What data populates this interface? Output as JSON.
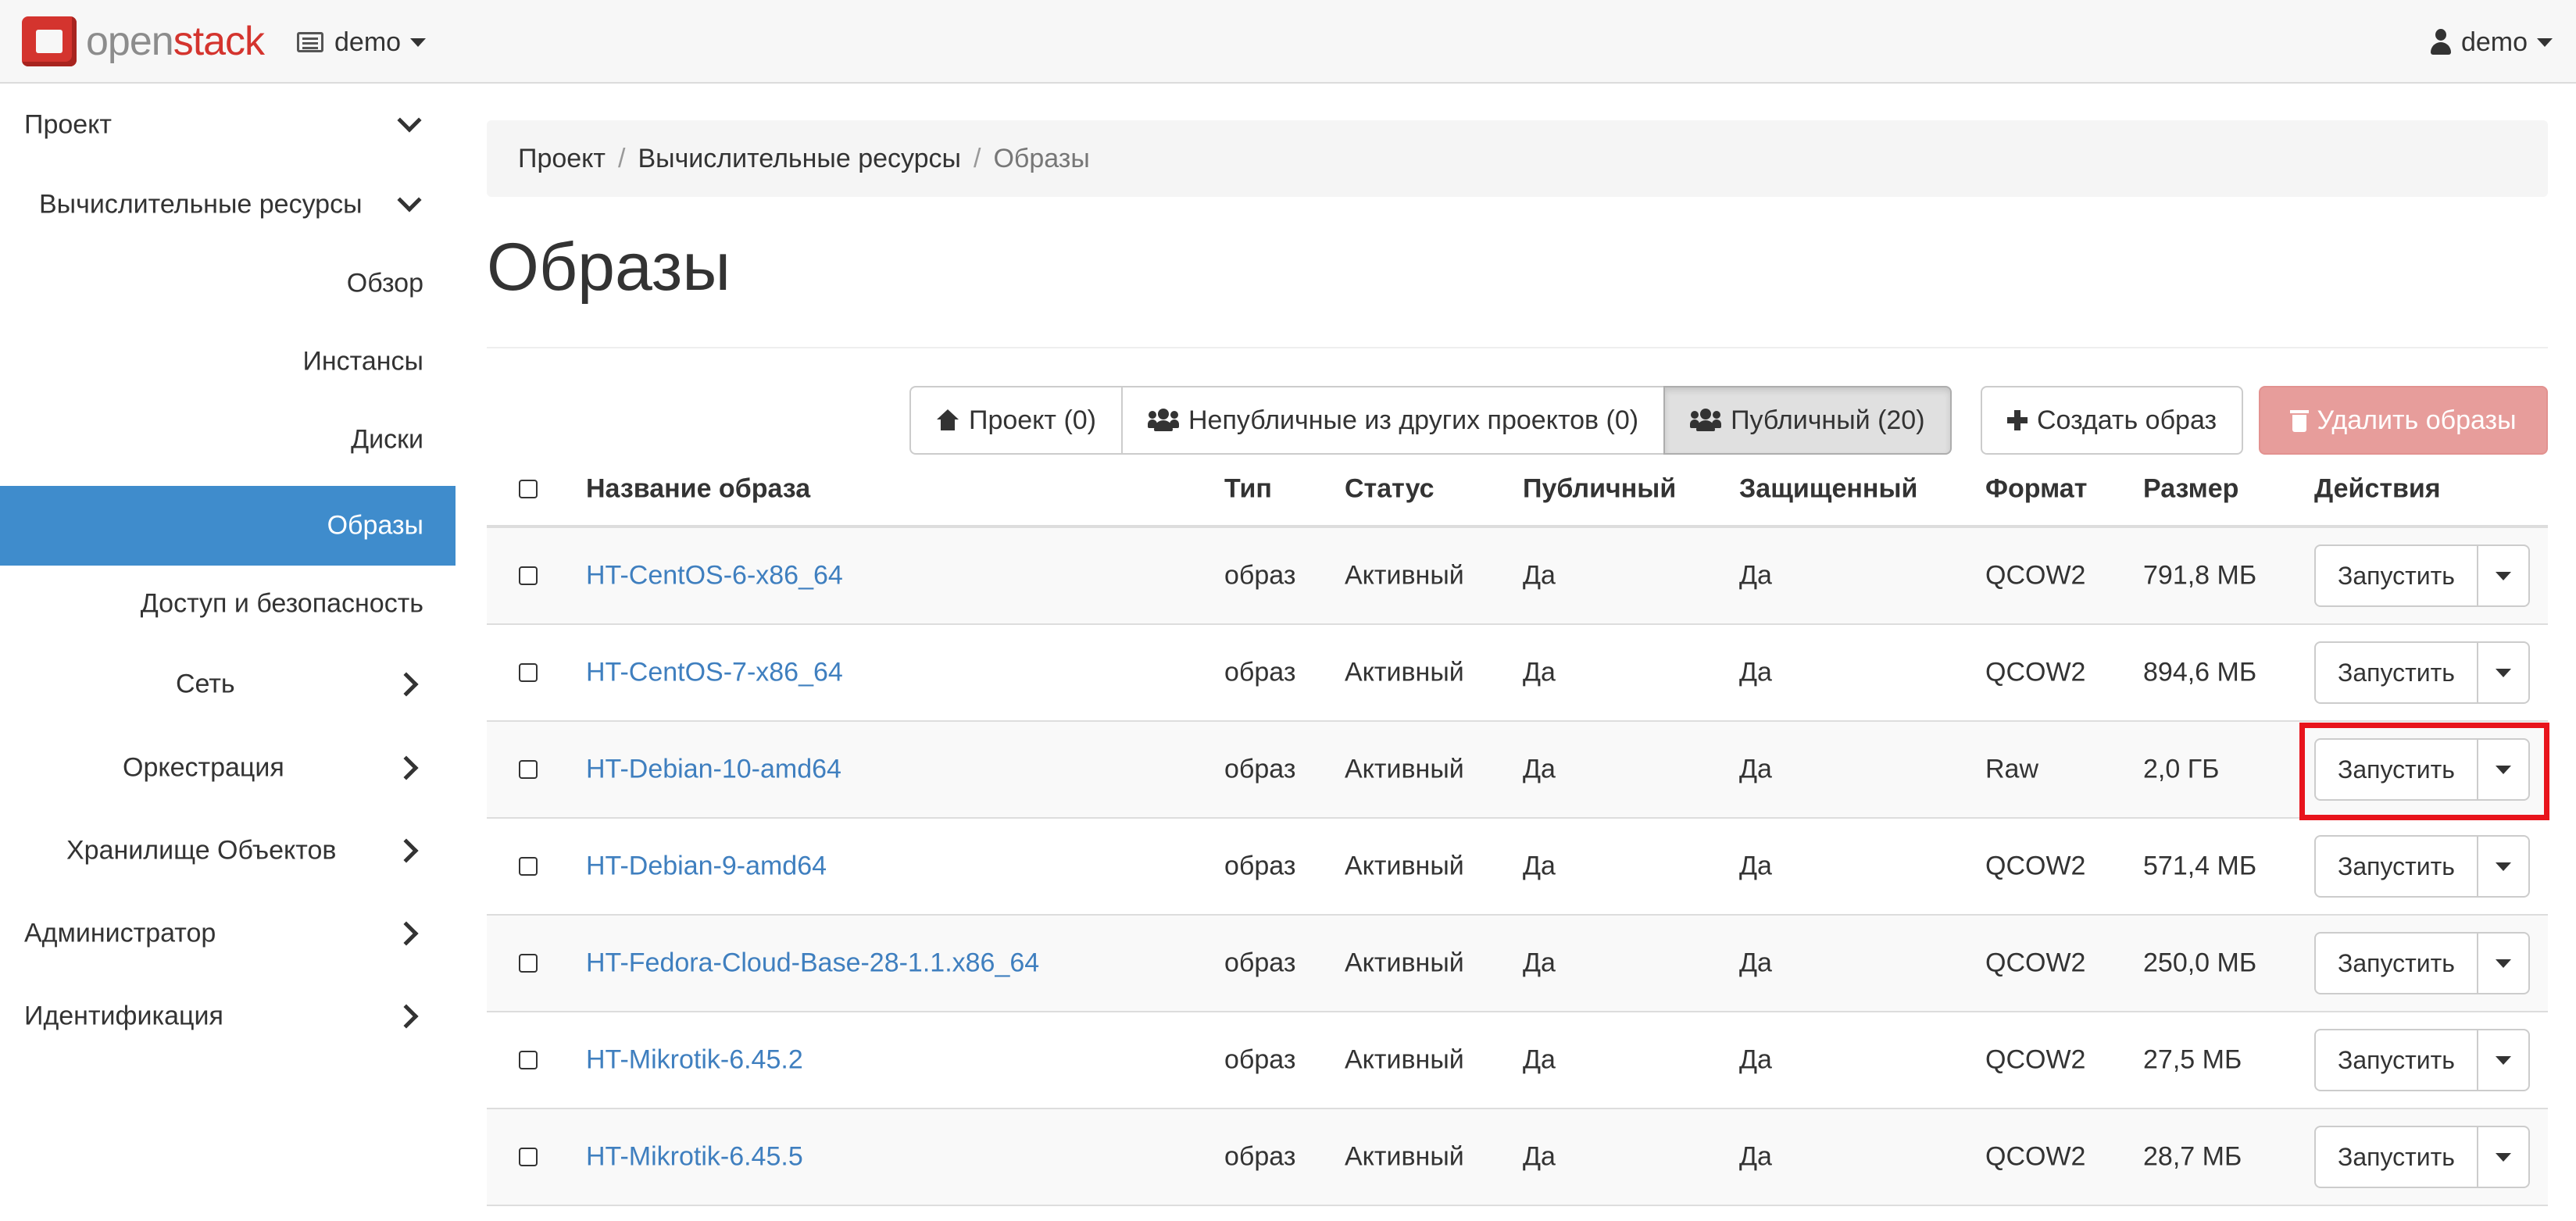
{
  "brand": {
    "logo_part1": "open",
    "logo_part2": "stack"
  },
  "header": {
    "project": "demo",
    "user": "demo"
  },
  "sidebar": {
    "items": [
      {
        "label": "Проект"
      },
      {
        "label": "Вычислительные ресурсы"
      },
      {
        "label": "Обзор"
      },
      {
        "label": "Инстансы"
      },
      {
        "label": "Диски"
      },
      {
        "label": "Образы"
      },
      {
        "label": "Доступ и безопасность"
      },
      {
        "label": "Сеть"
      },
      {
        "label": "Оркестрация"
      },
      {
        "label": "Хранилище Объектов"
      },
      {
        "label": "Администратор"
      },
      {
        "label": "Идентификация"
      }
    ]
  },
  "breadcrumb": {
    "items": [
      "Проект",
      "Вычислительные ресурсы",
      "Образы"
    ]
  },
  "page": {
    "title": "Образы"
  },
  "filters": {
    "project": "Проект (0)",
    "shared": "Непубличные из других проектов (0)",
    "public": "Публичный (20)",
    "create": "Создать образ",
    "delete": "Удалить образы"
  },
  "table": {
    "headers": {
      "name": "Название образа",
      "type": "Тип",
      "status": "Статус",
      "public": "Публичный",
      "protected": "Защищенный",
      "format": "Формат",
      "size": "Размер",
      "actions": "Действия"
    },
    "rows": [
      {
        "name": "HT-CentOS-6-x86_64",
        "type": "образ",
        "status": "Активный",
        "public": "Да",
        "protected": "Да",
        "format": "QCOW2",
        "size": "791,8 МБ",
        "action": "Запустить"
      },
      {
        "name": "HT-CentOS-7-x86_64",
        "type": "образ",
        "status": "Активный",
        "public": "Да",
        "protected": "Да",
        "format": "QCOW2",
        "size": "894,6 МБ",
        "action": "Запустить"
      },
      {
        "name": "HT-Debian-10-amd64",
        "type": "образ",
        "status": "Активный",
        "public": "Да",
        "protected": "Да",
        "format": "Raw",
        "size": "2,0 ГБ",
        "action": "Запустить"
      },
      {
        "name": "HT-Debian-9-amd64",
        "type": "образ",
        "status": "Активный",
        "public": "Да",
        "protected": "Да",
        "format": "QCOW2",
        "size": "571,4 МБ",
        "action": "Запустить"
      },
      {
        "name": "HT-Fedora-Cloud-Base-28-1.1.x86_64",
        "type": "образ",
        "status": "Активный",
        "public": "Да",
        "protected": "Да",
        "format": "QCOW2",
        "size": "250,0 МБ",
        "action": "Запустить"
      },
      {
        "name": "HT-Mikrotik-6.45.2",
        "type": "образ",
        "status": "Активный",
        "public": "Да",
        "protected": "Да",
        "format": "QCOW2",
        "size": "27,5 МБ",
        "action": "Запустить"
      },
      {
        "name": "HT-Mikrotik-6.45.5",
        "type": "образ",
        "status": "Активный",
        "public": "Да",
        "protected": "Да",
        "format": "QCOW2",
        "size": "28,7 МБ",
        "action": "Запустить"
      }
    ]
  },
  "colors": {
    "accent": "#3f8ccc",
    "link": "#3f7fbf",
    "danger": "#e79d9b",
    "highlight": "#e8141c",
    "brand": "#d4342e"
  }
}
